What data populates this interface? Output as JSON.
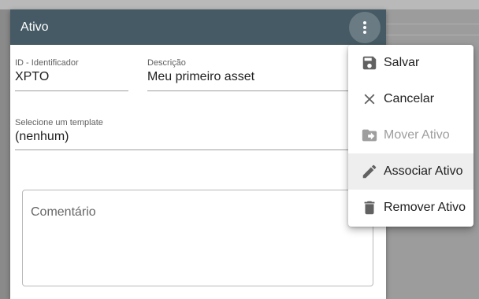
{
  "dialog": {
    "title": "Ativo"
  },
  "form": {
    "id_label": "ID - Identificador",
    "id_value": "XPTO",
    "description_label": "Descrição",
    "description_value": "Meu primeiro asset",
    "template_label": "Selecione um template",
    "template_value": "(nenhum)",
    "comment_placeholder": "Comentário"
  },
  "menu": {
    "items": [
      {
        "label": "Salvar",
        "icon": "save-icon",
        "enabled": true
      },
      {
        "label": "Cancelar",
        "icon": "close-icon",
        "enabled": true
      },
      {
        "label": "Mover Ativo",
        "icon": "move-folder-icon",
        "enabled": false
      },
      {
        "label": "Associar Ativo",
        "icon": "pencil-icon",
        "enabled": true,
        "highlighted": true
      },
      {
        "label": "Remover Ativo",
        "icon": "trash-icon",
        "enabled": true
      }
    ]
  },
  "colors": {
    "toolbar": "#455a64",
    "icon": "#616161",
    "disabled": "#9e9e9e"
  }
}
